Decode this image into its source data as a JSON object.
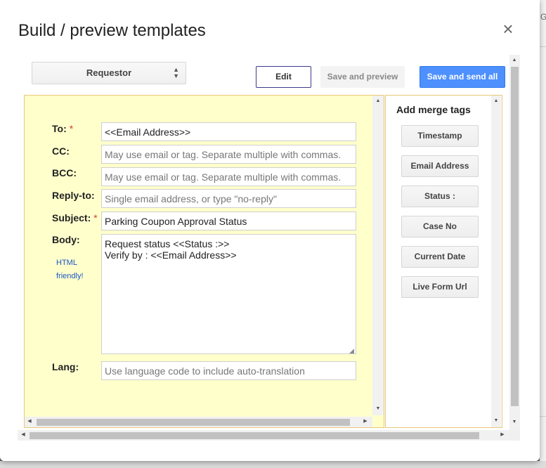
{
  "dialog": {
    "title": "Build / preview templates",
    "close_glyph": "×"
  },
  "toolbar": {
    "template_select": "Requestor",
    "edit_label": "Edit",
    "save_preview_label": "Save and preview",
    "save_send_all_label": "Save and send all"
  },
  "form": {
    "to": {
      "label": "To:",
      "required": "*",
      "value": "<<Email Address>>"
    },
    "cc": {
      "label": "CC:",
      "placeholder": "May use email or tag. Separate multiple with commas."
    },
    "bcc": {
      "label": "BCC:",
      "placeholder": "May use email or tag. Separate multiple with commas."
    },
    "reply_to": {
      "label": "Reply-to:",
      "placeholder": "Single email address, or type \"no-reply\""
    },
    "subject": {
      "label": "Subject:",
      "required": "*",
      "value": "Parking Coupon Approval Status"
    },
    "body": {
      "label": "Body:",
      "note_line1": "HTML",
      "note_line2": "friendly!",
      "value": "Request status <<Status :>>\nVerify by : <<Email Address>>"
    },
    "lang": {
      "label": "Lang:",
      "placeholder": "Use language code to include auto-translation"
    }
  },
  "merge_tags": {
    "title": "Add merge tags",
    "items": [
      "Timestamp",
      "Email Address",
      "Status :",
      "Case No",
      "Current Date",
      "Live Form Url"
    ]
  },
  "background": {
    "edge_letter": "G"
  },
  "colors": {
    "primary_button": "#4d90fe",
    "form_background": "#ffffcc",
    "required_asterisk": "#d23f31",
    "link_note": "#1a55c6"
  }
}
